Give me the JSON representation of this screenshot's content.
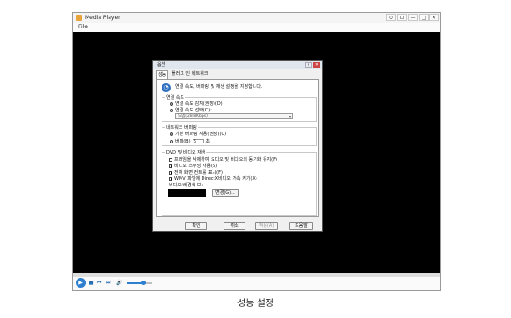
{
  "window": {
    "title": "Media Player",
    "buttons": [
      "⊙",
      "⊡",
      "—",
      "□",
      "✕"
    ]
  },
  "menu": {
    "file": "File"
  },
  "controls": {
    "play": "▶",
    "stop": "■",
    "prev": "⏮",
    "next": "⏭",
    "mute": "🔊"
  },
  "dialog": {
    "title": "옵션",
    "close": "✕",
    "help": "?",
    "tabs": [
      "성능",
      "플러그 인",
      "네트워크"
    ],
    "intro": "연결 속도, 버퍼링 및 재생 설정을 지정합니다.",
    "connection": {
      "title": "연결 속도",
      "opt_auto": "연결 속도 감지(권장)(D)",
      "opt_choose": "연결 속도 선택(C):",
      "selected_speed": "모뎀(28.8Kbps)"
    },
    "buffering": {
      "title": "네트워크 버퍼링",
      "opt_default": "기본 버퍼링 사용(권장)(U)",
      "opt_buffer": "버퍼(B)",
      "seconds_value": "5",
      "seconds_unit": "초"
    },
    "dvd": {
      "title": "DVD 및 비디오 재생",
      "items": [
        {
          "label": "프레임을 삭제하여 오디오 및 비디오의 동기화 유지(F)",
          "checked": false
        },
        {
          "label": "비디오 스무딩 사용(S)",
          "checked": true
        },
        {
          "label": "전체 화면 컨트롤 표시(F)",
          "checked": true
        },
        {
          "label": "WMV 파일에 DirectX비디오 가속 켜기(X)",
          "checked": true
        }
      ],
      "bg_label": "비디오 배경색 보:",
      "change_button": "변경(G)..."
    },
    "buttons": {
      "ok": "확인",
      "cancel": "취소",
      "apply": "적용(A)",
      "help": "도움말"
    }
  },
  "caption": "성능 설정",
  "colors": {
    "accent": "#2d7fd0",
    "video": "#000000"
  }
}
